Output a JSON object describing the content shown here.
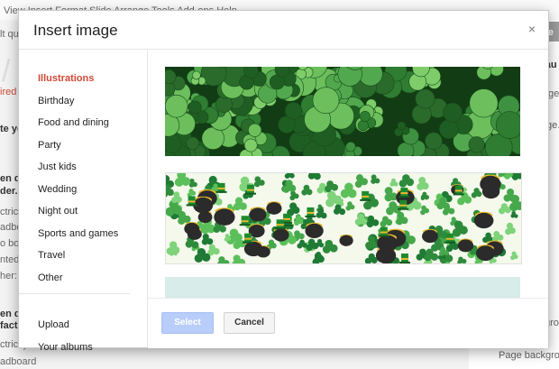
{
  "background": {
    "menu": "View   Insert   Format   Slide   Arrange   Tools   Add-ons   Help",
    "left_fragments": [
      "lt qu",
      "/",
      "ired",
      "te yo",
      "en d",
      "der.",
      "ctrici",
      "adbo",
      "o bo",
      "nted",
      "her:",
      "en d",
      "factu",
      "ctricity board",
      "adboard"
    ],
    "right_fragments": [
      "me",
      "Fau",
      "ge",
      "ge.",
      "grou",
      "Page backgro"
    ]
  },
  "dialog": {
    "title": "Insert image",
    "close_label": "×",
    "categories": [
      "Illustrations",
      "Birthday",
      "Food and dining",
      "Party",
      "Just kids",
      "Wedding",
      "Night out",
      "Sports and games",
      "Travel",
      "Other"
    ],
    "active_category": "Illustrations",
    "sources": [
      "Upload",
      "Your albums"
    ],
    "buttons": {
      "select": "Select",
      "cancel": "Cancel"
    }
  },
  "colors": {
    "accent_red": "#d14836",
    "select_disabled": "#b9cdfa",
    "clover_dark": "#1f6b2a",
    "clover_light": "#5cb85c",
    "pot_black": "#2b2b2b",
    "gold": "#e7b92f"
  }
}
